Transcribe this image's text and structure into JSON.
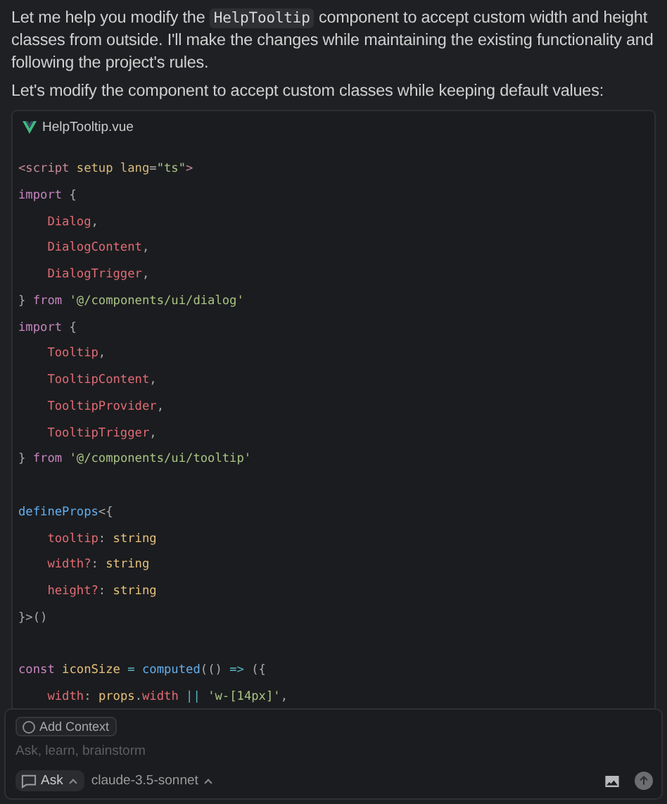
{
  "message": {
    "paragraphs": [
      {
        "segments": [
          {
            "kind": "text",
            "text": "Let me help you modify the "
          },
          {
            "kind": "code",
            "text": "HelpTooltip"
          },
          {
            "kind": "text",
            "text": " component to accept custom width and height classes from outside. I'll make the changes while maintaining the existing functionality and following the project's rules."
          }
        ]
      },
      {
        "segments": [
          {
            "kind": "text",
            "text": "Let's modify the component to accept custom classes while keeping default values:"
          }
        ]
      }
    ]
  },
  "code_block": {
    "filename": "HelpTooltip.vue",
    "lines": [
      {
        "kind": "code",
        "tokens": [
          {
            "kind": "tag",
            "text": "<script"
          },
          {
            "kind": "attr",
            "text": " setup lang"
          },
          {
            "kind": "punct",
            "text": "="
          },
          {
            "kind": "string",
            "text": "\"ts\""
          },
          {
            "kind": "tag",
            "text": ">"
          }
        ]
      },
      {
        "kind": "code",
        "tokens": [
          {
            "kind": "keyword",
            "text": "import"
          },
          {
            "kind": "punct",
            "text": " {"
          }
        ]
      },
      {
        "kind": "code",
        "tokens": [
          {
            "kind": "ident",
            "text": "    Dialog"
          },
          {
            "kind": "punct",
            "text": ","
          }
        ]
      },
      {
        "kind": "code",
        "tokens": [
          {
            "kind": "ident",
            "text": "    DialogContent"
          },
          {
            "kind": "punct",
            "text": ","
          }
        ]
      },
      {
        "kind": "code",
        "tokens": [
          {
            "kind": "ident",
            "text": "    DialogTrigger"
          },
          {
            "kind": "punct",
            "text": ","
          }
        ]
      },
      {
        "kind": "code",
        "tokens": [
          {
            "kind": "punct",
            "text": "}"
          },
          {
            "kind": "keyword",
            "text": " from"
          },
          {
            "kind": "string",
            "text": " '@/components/ui/dialog'"
          }
        ]
      },
      {
        "kind": "code",
        "tokens": [
          {
            "kind": "keyword",
            "text": "import"
          },
          {
            "kind": "punct",
            "text": " {"
          }
        ]
      },
      {
        "kind": "code",
        "tokens": [
          {
            "kind": "ident",
            "text": "    Tooltip"
          },
          {
            "kind": "punct",
            "text": ","
          }
        ]
      },
      {
        "kind": "code",
        "tokens": [
          {
            "kind": "ident",
            "text": "    TooltipContent"
          },
          {
            "kind": "punct",
            "text": ","
          }
        ]
      },
      {
        "kind": "code",
        "tokens": [
          {
            "kind": "ident",
            "text": "    TooltipProvider"
          },
          {
            "kind": "punct",
            "text": ","
          }
        ]
      },
      {
        "kind": "code",
        "tokens": [
          {
            "kind": "ident",
            "text": "    TooltipTrigger"
          },
          {
            "kind": "punct",
            "text": ","
          }
        ]
      },
      {
        "kind": "code",
        "tokens": [
          {
            "kind": "punct",
            "text": "}"
          },
          {
            "kind": "keyword",
            "text": " from"
          },
          {
            "kind": "string",
            "text": " '@/components/ui/tooltip'"
          }
        ]
      },
      {
        "kind": "blank"
      },
      {
        "kind": "code",
        "tokens": [
          {
            "kind": "function",
            "text": "defineProps"
          },
          {
            "kind": "punct",
            "text": "<{"
          }
        ]
      },
      {
        "kind": "code",
        "tokens": [
          {
            "kind": "ident",
            "text": "    tooltip"
          },
          {
            "kind": "punct",
            "text": ": "
          },
          {
            "kind": "type",
            "text": "string"
          }
        ]
      },
      {
        "kind": "code",
        "tokens": [
          {
            "kind": "ident",
            "text": "    width?"
          },
          {
            "kind": "punct",
            "text": ": "
          },
          {
            "kind": "type",
            "text": "string"
          }
        ]
      },
      {
        "kind": "code",
        "tokens": [
          {
            "kind": "ident",
            "text": "    height?"
          },
          {
            "kind": "punct",
            "text": ": "
          },
          {
            "kind": "type",
            "text": "string"
          }
        ]
      },
      {
        "kind": "code",
        "tokens": [
          {
            "kind": "punct",
            "text": "}>()"
          }
        ]
      },
      {
        "kind": "blank"
      },
      {
        "kind": "code",
        "tokens": [
          {
            "kind": "keyword",
            "text": "const"
          },
          {
            "kind": "type",
            "text": " iconSize"
          },
          {
            "kind": "operator",
            "text": " ="
          },
          {
            "kind": "function",
            "text": " computed"
          },
          {
            "kind": "punct",
            "text": "(() "
          },
          {
            "kind": "operator",
            "text": "=>"
          },
          {
            "kind": "punct",
            "text": " ({"
          }
        ]
      },
      {
        "kind": "code",
        "tokens": [
          {
            "kind": "ident",
            "text": "    width"
          },
          {
            "kind": "punct",
            "text": ": "
          },
          {
            "kind": "type",
            "text": "props"
          },
          {
            "kind": "punct",
            "text": "."
          },
          {
            "kind": "ident",
            "text": "width"
          },
          {
            "kind": "operator",
            "text": " ||"
          },
          {
            "kind": "string",
            "text": " 'w-[14px]'"
          },
          {
            "kind": "punct",
            "text": ","
          }
        ]
      }
    ]
  },
  "composer": {
    "context_button": "Add Context",
    "placeholder": "Ask, learn, brainstorm",
    "mode": "Ask",
    "model": "claude-3.5-sonnet"
  }
}
